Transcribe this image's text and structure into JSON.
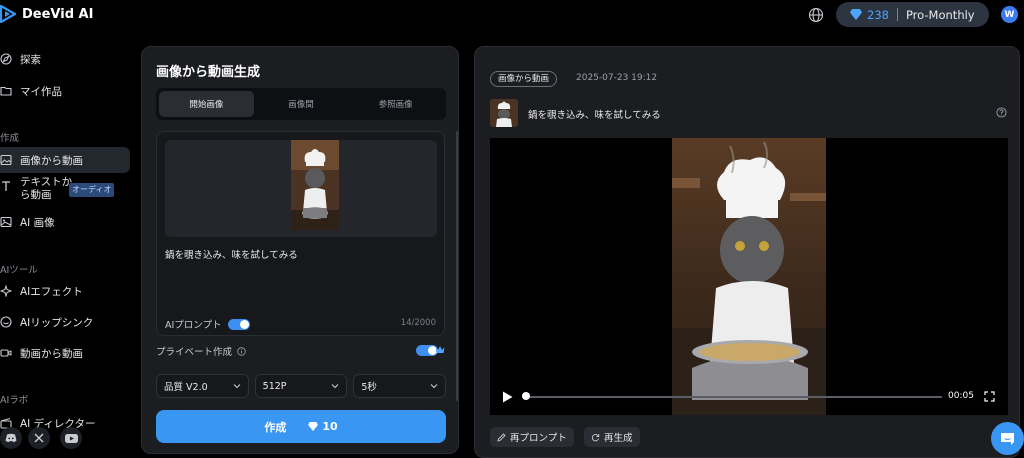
{
  "app": {
    "name": "DeeVid AI"
  },
  "header": {
    "credits": "238",
    "plan": "Pro-Monthly",
    "avatar_initial": "W",
    "accent": "#3a96f3"
  },
  "sidebar": {
    "items_top": [
      {
        "label": "探索",
        "icon": "compass-icon"
      },
      {
        "label": "マイ作品",
        "icon": "folder-icon"
      }
    ],
    "section_create": "作成",
    "items_create": [
      {
        "label": "画像から動画",
        "icon": "image-icon",
        "active": true
      },
      {
        "label_line1": "テキストか",
        "label_line2": "ら動画",
        "icon": "text-icon",
        "badge": "オーディオ"
      },
      {
        "label": "AI 画像",
        "icon": "image-icon"
      }
    ],
    "section_tools": "AIツール",
    "items_tools": [
      {
        "label": "AIエフェクト",
        "icon": "effect-icon"
      },
      {
        "label": "AIリップシンク",
        "icon": "lipsync-icon"
      },
      {
        "label": "動画から動画",
        "icon": "video-icon"
      }
    ],
    "section_lab": "AIラボ",
    "items_lab": [
      {
        "label": "AI ディレクター",
        "icon": "director-icon"
      }
    ]
  },
  "generator": {
    "title": "画像から動画生成",
    "tabs": [
      "開始画像",
      "画像間",
      "参照画像"
    ],
    "active_tab": 0,
    "prompt": "鍋を覗き込み、味を試してみる",
    "ai_prompt_label": "AIプロンプト",
    "ai_prompt_enabled": true,
    "char_count": "14/2000",
    "private_label": "プライベート作成",
    "private_enabled": true,
    "quality": "品質 V2.0",
    "resolution": "512P",
    "duration": "5秒",
    "create_label": "作成",
    "create_cost": "10"
  },
  "result": {
    "tag": "画像から動画",
    "timestamp": "2025-07-23 19:12",
    "prompt": "鍋を覗き込み、味を試してみる",
    "video_time": "00:05",
    "video_progress": 0.0,
    "reprompt_label": "再プロンプト",
    "regenerate_label": "再生成"
  }
}
